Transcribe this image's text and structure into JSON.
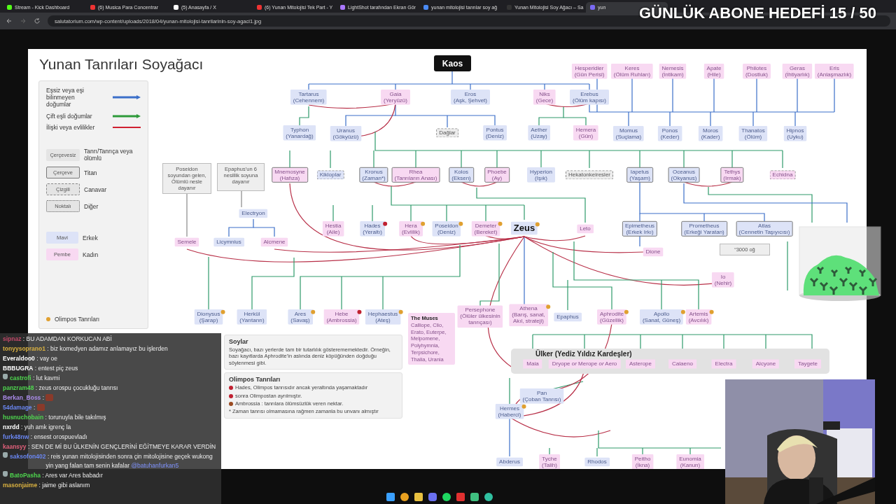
{
  "browser": {
    "tabs": [
      {
        "title": "Stream - Kick Dashboard",
        "selected": false
      },
      {
        "title": "(6) Musica Para Concentrar",
        "selected": false
      },
      {
        "title": "(5) Anasayfa / X",
        "selected": false
      },
      {
        "title": "(6) Yunan Mitolojisi Tek Part - Y",
        "selected": false
      },
      {
        "title": "LightShot tarafından Ekran Gör",
        "selected": false
      },
      {
        "title": "yunan mitolojisi tanrılar soy ağ",
        "selected": false
      },
      {
        "title": "Yunan Mitolojisi Soy Ağacı – Sa",
        "selected": false
      },
      {
        "title": "yun",
        "selected": true
      }
    ],
    "url": "salutatorium.com/wp-content/uploads/2018/04/yunan-mitolojisi-tanrilarinin-soy-agaci1.jpg"
  },
  "goal": "GÜNLÜK ABONE HEDEFİ 15 / 50",
  "chart": {
    "title": "Yunan Tanrıları Soyağacı",
    "root": "Kaos",
    "legend": {
      "lines": [
        {
          "label": "Eşsiz veya eşi bilinmeyen doğumlar",
          "kind": "arrow",
          "color": "#3b6fc9"
        },
        {
          "label": "Çift eşli doğumlar",
          "kind": "arrow",
          "color": "#2e9a3a"
        },
        {
          "label": "İlişki veya evlilikler",
          "kind": "line",
          "color": "#d02030"
        }
      ],
      "borders": [
        {
          "sample": "Çerçevesiz",
          "label": "Tanrı/Tanrıça veya ölümlü",
          "kind": "plain"
        },
        {
          "sample": "Çerçeve",
          "label": "Titan",
          "kind": "titan"
        },
        {
          "sample": "Çizgili",
          "label": "Canavar",
          "kind": "monster"
        },
        {
          "sample": "Noktalı",
          "label": "Diğer",
          "kind": "other"
        }
      ],
      "genders": [
        {
          "sample": "Mavi",
          "label": "Erkek",
          "female": false
        },
        {
          "sample": "Pembe",
          "label": "Kadın",
          "female": true
        }
      ],
      "badge": "Olimpos Tanrıları"
    },
    "nodes": [
      {
        "lines": [
          "Hesperidler",
          "(Gün Perisi)"
        ],
        "female": true,
        "kind": "plain"
      },
      {
        "lines": [
          "Keres",
          "(Ölüm Ruhları)"
        ],
        "female": true,
        "kind": "plain"
      },
      {
        "lines": [
          "Nemesis",
          "(İntikam)"
        ],
        "female": true,
        "kind": "plain"
      },
      {
        "lines": [
          "Apate",
          "(Hile)"
        ],
        "female": true,
        "kind": "plain"
      },
      {
        "lines": [
          "Philotes",
          "(Dostluk)"
        ],
        "female": true,
        "kind": "plain"
      },
      {
        "lines": [
          "Geras",
          "(İhtiyarlık)"
        ],
        "female": true,
        "kind": "plain"
      },
      {
        "lines": [
          "Eris",
          "(Anlaşmazlık)"
        ],
        "female": true,
        "kind": "plain"
      },
      {
        "lines": [
          "Tartarus",
          "(Cehennem)"
        ],
        "female": false,
        "kind": "plain"
      },
      {
        "lines": [
          "Gaia",
          "(Yeryüzü)"
        ],
        "female": true,
        "kind": "plain"
      },
      {
        "lines": [
          "Eros",
          "(Aşk, Şehvet)"
        ],
        "female": false,
        "kind": "plain"
      },
      {
        "lines": [
          "Niks",
          "(Gece)"
        ],
        "female": true,
        "kind": "plain"
      },
      {
        "lines": [
          "Erebus",
          "(Ölüm kapısı)"
        ],
        "female": false,
        "kind": "plain"
      },
      {
        "lines": [
          "Typhon",
          "(Yanardağ)"
        ],
        "female": false,
        "kind": "plain"
      },
      {
        "lines": [
          "Uranus",
          "(Gökyüzü)"
        ],
        "female": false,
        "kind": "plain"
      },
      {
        "lines": [
          "Dağlar"
        ],
        "neutral": true,
        "kind": "monster"
      },
      {
        "lines": [
          "Pontus",
          "(Deniz)"
        ],
        "female": false,
        "kind": "plain"
      },
      {
        "lines": [
          "Aether",
          "(Uzay)"
        ],
        "female": false,
        "kind": "plain"
      },
      {
        "lines": [
          "Hemera",
          "(Gün)"
        ],
        "female": true,
        "kind": "plain"
      },
      {
        "lines": [
          "Momus",
          "(Suçlama)"
        ],
        "female": false,
        "kind": "plain"
      },
      {
        "lines": [
          "Ponos",
          "(Keder)"
        ],
        "female": false,
        "kind": "plain"
      },
      {
        "lines": [
          "Moros",
          "(Kader)"
        ],
        "female": false,
        "kind": "plain"
      },
      {
        "lines": [
          "Thanatos",
          "(Ölüm)"
        ],
        "female": false,
        "kind": "plain"
      },
      {
        "lines": [
          "Hipnos",
          "(Uyku)"
        ],
        "female": false,
        "kind": "plain"
      },
      {
        "lines": [
          "Mnemosyne",
          "(Hafıza)"
        ],
        "female": true,
        "kind": "titan"
      },
      {
        "lines": [
          "Kikloplar"
        ],
        "female": false,
        "kind": "monster"
      },
      {
        "lines": [
          "Kronus",
          "(Zaman*)"
        ],
        "female": false,
        "kind": "titan"
      },
      {
        "lines": [
          "Rhea",
          "(Tanrıların Anası)"
        ],
        "female": true,
        "kind": "titan"
      },
      {
        "lines": [
          "Kolos",
          "(Eksen)"
        ],
        "female": false,
        "kind": "titan"
      },
      {
        "lines": [
          "Phoebe",
          "(Ay)"
        ],
        "female": true,
        "kind": "titan"
      },
      {
        "lines": [
          "Hyperion",
          "(Işık)"
        ],
        "female": false,
        "kind": "plain"
      },
      {
        "lines": [
          "Hekatonkeiresler"
        ],
        "neutral": true,
        "kind": "monster"
      },
      {
        "lines": [
          "Iapetus",
          "(Yaşam)"
        ],
        "female": false,
        "kind": "titan"
      },
      {
        "lines": [
          "Oceanus",
          "(Okyanus)"
        ],
        "female": false,
        "kind": "titan"
      },
      {
        "lines": [
          "Tethys",
          "(Irmak)"
        ],
        "female": true,
        "kind": "titan"
      },
      {
        "lines": [
          "Echidna"
        ],
        "female": true,
        "kind": "monster"
      },
      {
        "lines": [
          "Electryon"
        ],
        "female": false,
        "kind": "plain"
      },
      {
        "lines": [
          "Hestia",
          "(Aile)"
        ],
        "female": true,
        "kind": "plain"
      },
      {
        "lines": [
          "Hades",
          "(Yeraltı)"
        ],
        "female": false,
        "kind": "plain",
        "footnote": true
      },
      {
        "lines": [
          "Hera",
          "(Evlilik)"
        ],
        "female": true,
        "kind": "plain",
        "olympian": true
      },
      {
        "lines": [
          "Poseidon",
          "(Deniz)"
        ],
        "female": false,
        "kind": "plain",
        "olympian": true
      },
      {
        "lines": [
          "Demeter",
          "(Bereket)"
        ],
        "female": true,
        "kind": "plain",
        "olympian": true
      },
      {
        "lines": [
          "Zeus"
        ],
        "female": false,
        "kind": "plain",
        "olympian": true,
        "main": true
      },
      {
        "lines": [
          "Leto"
        ],
        "female": true,
        "kind": "plain"
      },
      {
        "lines": [
          "Epimetheus",
          "(Erkek Irkı)"
        ],
        "female": false,
        "kind": "titan"
      },
      {
        "lines": [
          "Prometheus",
          "(Erkeği Yaratan)"
        ],
        "female": false,
        "kind": "titan"
      },
      {
        "lines": [
          "Atlas",
          "(Cennetin Taşıyıcısı)"
        ],
        "female": false,
        "kind": "titan"
      },
      {
        "lines": [
          "Semele"
        ],
        "female": true,
        "kind": "plain"
      },
      {
        "lines": [
          "Licymnius"
        ],
        "female": false,
        "kind": "plain"
      },
      {
        "lines": [
          "Alcmene"
        ],
        "female": true,
        "kind": "plain"
      },
      {
        "lines": [
          "Dione"
        ],
        "female": true,
        "kind": "plain"
      },
      {
        "lines": [
          "Io",
          "(Nehir)"
        ],
        "female": true,
        "kind": "plain"
      },
      {
        "lines": [
          "Dionysus",
          "(Şarap)"
        ],
        "female": false,
        "kind": "plain",
        "olympian": true
      },
      {
        "lines": [
          "Herkül",
          "(Yarıtanrı)"
        ],
        "female": false,
        "kind": "plain"
      },
      {
        "lines": [
          "Ares",
          "(Savaş)"
        ],
        "female": false,
        "kind": "plain",
        "olympian": true
      },
      {
        "lines": [
          "Hebe",
          "(Ambrossia)"
        ],
        "female": true,
        "kind": "plain",
        "footnote": true
      },
      {
        "lines": [
          "Hephaestus",
          "(Ateş)"
        ],
        "female": false,
        "kind": "plain",
        "olympian": true
      },
      {
        "lines": [
          "Persephone",
          "(Ölüler ülkesinin",
          "tanrıçası)"
        ],
        "female": true,
        "kind": "plain"
      },
      {
        "lines": [
          "Athena",
          "(Barış, sanat,",
          "Akıl, strateji)"
        ],
        "female": true,
        "kind": "plain",
        "olympian": true
      },
      {
        "lines": [
          "Epaphus"
        ],
        "female": false,
        "kind": "plain"
      },
      {
        "lines": [
          "Aphrodite",
          "(Güzellik)"
        ],
        "female": true,
        "kind": "plain",
        "olympian": true
      },
      {
        "lines": [
          "Apollo",
          "(Sanat, Güneş)"
        ],
        "female": false,
        "kind": "plain",
        "olympian": true
      },
      {
        "lines": [
          "Artemis",
          "(Avcılık)"
        ],
        "female": true,
        "kind": "plain",
        "olympian": true
      },
      {
        "lines": [
          "Pan",
          "(Çoban Tanrısı)"
        ],
        "female": false,
        "kind": "plain"
      },
      {
        "lines": [
          "Hermes",
          "(Haberci)"
        ],
        "female": false,
        "kind": "plain",
        "olympian": true
      },
      {
        "lines": [
          "Abderus"
        ],
        "female": false,
        "kind": "plain"
      },
      {
        "lines": [
          "Tyche",
          "(Talih)"
        ],
        "female": true,
        "kind": "plain"
      },
      {
        "lines": [
          "Rhodos"
        ],
        "female": false,
        "kind": "plain"
      },
      {
        "lines": [
          "Peitho",
          "(İkna)"
        ],
        "female": true,
        "kind": "plain"
      },
      {
        "lines": [
          "Eunomia",
          "(Kanun)"
        ],
        "female": true,
        "kind": "plain"
      }
    ],
    "remarks": [
      "Poseidon soyundan gelen, Ölümlü nesle dayanır",
      "Epaphus’un 6 nesillik soyuna dayanır",
      "“3000 oğ"
    ],
    "muses": {
      "title": "The Muses",
      "text": "Calliope, Clio, Erato, Euterpe, Melpomene, Polyhymnia, Terpsichore, Thalia, Urania"
    },
    "group": {
      "title": "Ülker (Yediz Yıldız Kardeşler)",
      "members": [
        "Maia",
        "Dryope *or* Merope *or* Aero",
        "Asterope",
        "Calaeno",
        "Electra",
        "Alcyone",
        "Taygete"
      ]
    },
    "notes": [
      {
        "title": "Soylar",
        "items": [
          {
            "text": "Soyağacı, bazı yerlerde tam bir tutarlılık gösterememektedir. Örneğin, bazı kayıtlarda Aphrodite’in aslında deniz köpüğünden doğduğu söylenmesi gibi."
          }
        ]
      },
      {
        "title": "Olimpos Tanrıları",
        "items": [
          {
            "text": "Hades, Olimpos tanrısıdır ancak yeraltında yaşamaktadır",
            "color": "#c02030"
          },
          {
            "text": "sonra Olimpostan ayrılmıştır.",
            "color": "#c02030"
          },
          {
            "text": "Ambrossia : tanrılara ölümsüzlük veren nektar.",
            "color": "#9a4a20"
          },
          {
            "text": "* Zaman tanrısı olmamasına rağmen zamanla bu unvanı almıştır"
          }
        ]
      }
    ]
  },
  "chat": {
    "separator": " : ",
    "messages": [
      {
        "user": "sipnaz",
        "color": "#c04868",
        "text": "BU ADAMDAN KORKUCAN ABİ"
      },
      {
        "user": "tonyysoprano1",
        "color": "#d8b040",
        "text": "biz komedyen adamız anlamayız bu işlerden"
      },
      {
        "user": "Everaldoo0",
        "color": "#ffffff",
        "text": "vay oe"
      },
      {
        "user": "BBBUGRA",
        "color": "#ffffff",
        "text": "entest piç zeus"
      },
      {
        "user": "castrofi",
        "color": "#4ed44e",
        "text": "lut kavmi",
        "badge": true
      },
      {
        "user": "panzram48",
        "color": "#4ed44e",
        "text": "zeus orospu çocukluğu tanrısı"
      },
      {
        "user": "Berkan_Boss",
        "color": "#a98ae8",
        "emote": true
      },
      {
        "user": "54damage",
        "color": "#6a86f0",
        "emote": true
      },
      {
        "user": "husnuchobain",
        "color": "#4ed44e",
        "text": "torunuyla bile takılmış"
      },
      {
        "user": "nxrdd",
        "color": "#ffffff",
        "text": "yuh amk igrenç la"
      },
      {
        "user": "furk48nw",
        "color": "#6a86f0",
        "text": "ensest orospuevladı"
      },
      {
        "user": "kaansyy",
        "color": "#e0607a",
        "text": "SEN DE Mİ BU ÜLKENİN GENÇLERİNİ EĞİTMEYE KARAR VERDİN"
      },
      {
        "user": "saksofon402",
        "color": "#6a86f0",
        "text": "reis yunan mitolojisinden sonra çin mitolojisine geçek wukong yin yang falan tam senin kafalar",
        "mention": "@batuhanfurkan5",
        "badge": true
      },
      {
        "user": "BatoPasha",
        "color": "#4ed44e",
        "text": "Ares var Ares babadır",
        "badge": true
      },
      {
        "user": "masonjaime",
        "color": "#d8b040",
        "text": "jaime gibi aslanım"
      }
    ]
  }
}
